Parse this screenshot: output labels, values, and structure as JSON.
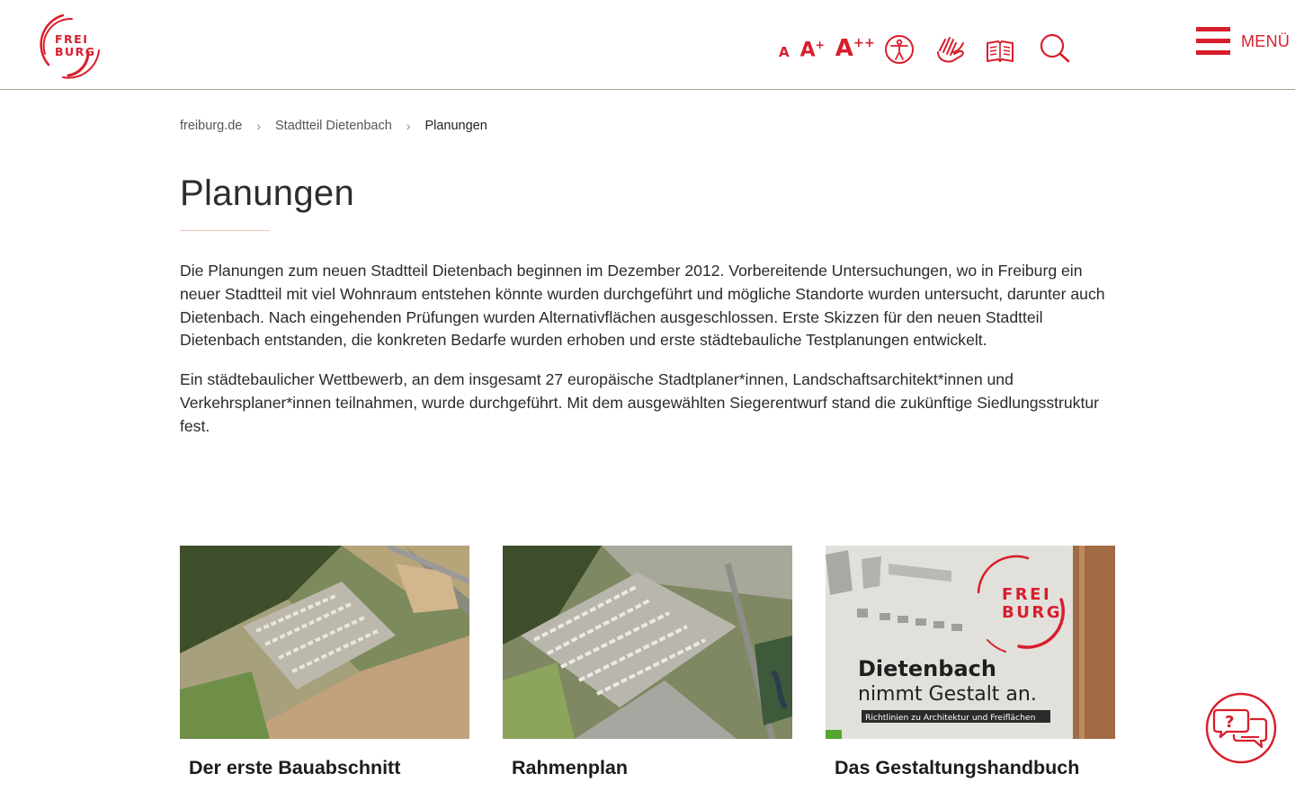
{
  "header": {
    "logo_line1": "FREI",
    "logo_line2": "BURG",
    "font_small": "A",
    "font_medium": "A",
    "font_medium_sup": "+",
    "font_large": "A",
    "font_large_sup": "++",
    "icons": [
      "accessibility-icon",
      "sign-language-icon",
      "easy-language-icon",
      "search-icon"
    ],
    "menu_label": "MENÜ",
    "accent_color": "#d81e2c"
  },
  "breadcrumb": {
    "items": [
      "freiburg.de",
      "Stadtteil Dietenbach"
    ],
    "current": "Planungen",
    "separator": "›"
  },
  "main": {
    "title": "Planungen",
    "paragraphs": [
      "Die Planungen zum neuen Stadtteil Dietenbach beginnen im Dezember 2012. Vorbereitende Untersuchungen, wo in Freiburg ein neuer Stadtteil mit viel Wohnraum entstehen könnte wurden durchgeführt und mögliche Standorte wurden untersucht, darunter auch Dietenbach. Nach eingehenden Prüfungen wurden Alternativflächen ausgeschlossen. Erste Skizzen für den neuen Stadtteil Dietenbach entstanden, die konkreten Bedarfe wurden erhoben und erste städtebauliche Testplanungen entwickelt.",
      "Ein städtebaulicher Wettbewerb, an dem insgesamt 27 europäische Stadtplaner*innen, Landschaftsarchitekt*innen und Verkehrsplaner*innen teilnahmen, wurde durchgeführt. Mit dem ausgewählten Siegerentwurf stand die zukünftige Siedlungsstruktur fest."
    ]
  },
  "cards": [
    {
      "title": "Der erste Bauabschnitt"
    },
    {
      "title": "Rahmenplan"
    },
    {
      "title": "Das Gestaltungshandbuch",
      "image_logo_line1": "FREI",
      "image_logo_line2": "BURG",
      "image_headline": "Dietenbach",
      "image_subline": "nimmt Gestalt an.",
      "image_tag": "Richtlinien zu Architektur und Freiflächen"
    }
  ],
  "chat": {
    "icon": "chat-help-icon"
  }
}
